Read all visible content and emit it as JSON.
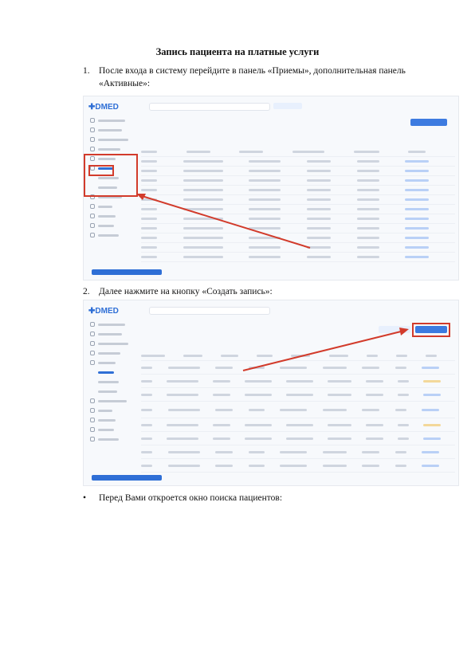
{
  "title": "Запись пациента на платные услуги",
  "steps": [
    {
      "num": "1.",
      "text": "После входа в систему перейдите в панель «Приемы», дополнительная панель «Активные»:"
    },
    {
      "num": "2.",
      "text": "Далее нажмите на кнопку «Создать запись»:"
    }
  ],
  "bullet": {
    "symbol": "•",
    "text": "Перед Вами откроется окно поиска пациентов:"
  },
  "screenshot_logo": "DMED",
  "colors": {
    "highlight": "#d23b2b",
    "accent": "#2f6fd6"
  }
}
